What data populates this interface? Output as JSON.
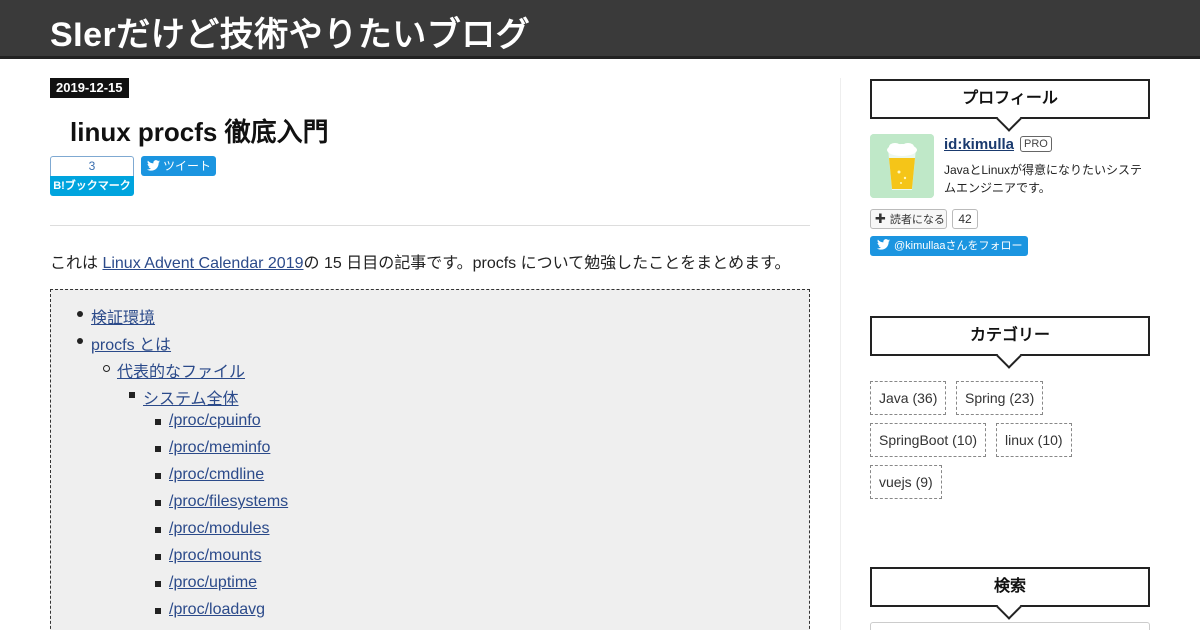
{
  "site": {
    "title": "SIerだけど技術やりたいブログ"
  },
  "entry": {
    "date": "2019-12-15",
    "title": "linux procfs 徹底入門",
    "bookmark_count": "3",
    "bookmark_label": "B!ブックマーク",
    "tweet_label": "ツイート",
    "intro_prefix": "これは ",
    "intro_link": "Linux Advent Calendar 2019",
    "intro_suffix": "の 15 日目の記事です。procfs について勉強したことをまとめます。"
  },
  "toc": [
    {
      "label": "検証環境",
      "level": 1
    },
    {
      "label": "procfs とは",
      "level": 1
    },
    {
      "label": "代表的なファイル",
      "level": 2
    },
    {
      "label": "システム全体",
      "level": 3
    },
    {
      "label": "/proc/cpuinfo",
      "level": 4
    },
    {
      "label": "/proc/meminfo",
      "level": 4
    },
    {
      "label": "/proc/cmdline",
      "level": 4
    },
    {
      "label": "/proc/filesystems",
      "level": 4
    },
    {
      "label": "/proc/modules",
      "level": 4
    },
    {
      "label": "/proc/mounts",
      "level": 4
    },
    {
      "label": "/proc/uptime",
      "level": 4
    },
    {
      "label": "/proc/loadavg",
      "level": 4
    }
  ],
  "sidebar": {
    "profile": {
      "heading": "プロフィール",
      "id": "id:kimulla",
      "badge": "PRO",
      "description": "JavaとLinuxが得意になりたいシステムエンジニアです。",
      "reader_label": "読者になる",
      "reader_count": "42",
      "follow_label": "@kimullaaさんをフォロー"
    },
    "categories": {
      "heading": "カテゴリー",
      "items": [
        {
          "label": "Java (36)"
        },
        {
          "label": "Spring (23)"
        },
        {
          "label": "SpringBoot (10)"
        },
        {
          "label": "linux (10)"
        },
        {
          "label": "vuejs (9)"
        }
      ]
    },
    "search": {
      "heading": "検索"
    }
  },
  "colors": {
    "header_bg": "#3a3a3a",
    "link": "#2b4a8a",
    "twitter": "#1b95e0",
    "hatena": "#00a4de",
    "toc_bg": "#efefef"
  }
}
